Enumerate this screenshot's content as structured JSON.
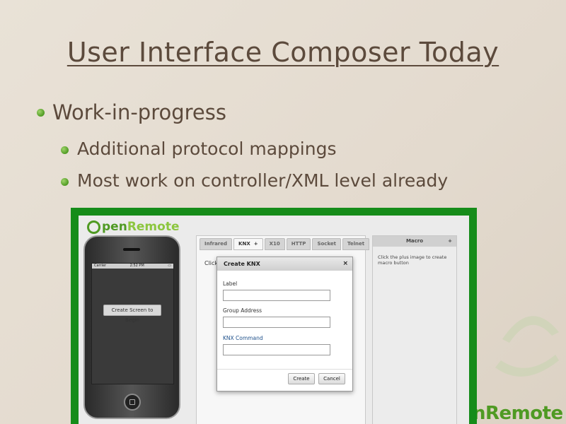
{
  "slide": {
    "title": "User Interface Composer Today",
    "bullets": [
      {
        "text": "Work-in-progress"
      },
      {
        "text": "Additional protocol mappings"
      },
      {
        "text": "Most work on controller/XML level already"
      }
    ],
    "bg_logo_text": "nRemote"
  },
  "screenshot": {
    "logo": {
      "open": "pen",
      "remote": "Remote"
    },
    "phone": {
      "carrier": "Carrier",
      "time": "2:52 PM",
      "begin_button": "Create Screen to Begin"
    },
    "tabs": [
      {
        "label": "Infrared",
        "active": false
      },
      {
        "label": "KNX",
        "active": true,
        "plus": "+"
      },
      {
        "label": "X10",
        "active": false
      },
      {
        "label": "HTTP",
        "active": false
      },
      {
        "label": "Socket",
        "active": false
      },
      {
        "label": "Telnet",
        "active": false
      }
    ],
    "panel_hint": "Click",
    "macro": {
      "header": "Macro",
      "plus": "+",
      "hint": "Click the plus image to create macro button"
    },
    "dialog": {
      "title": "Create KNX",
      "close": "×",
      "fields": [
        {
          "label": "Label",
          "value": ""
        },
        {
          "label": "Group Address",
          "value": ""
        },
        {
          "label": "KNX Command",
          "value": ""
        }
      ],
      "create_button": "Create",
      "cancel_button": "Cancel"
    }
  },
  "colors": {
    "accent_green": "#4f9a23",
    "frame_green": "#168c1a",
    "text_brown": "#5c4a3c"
  }
}
